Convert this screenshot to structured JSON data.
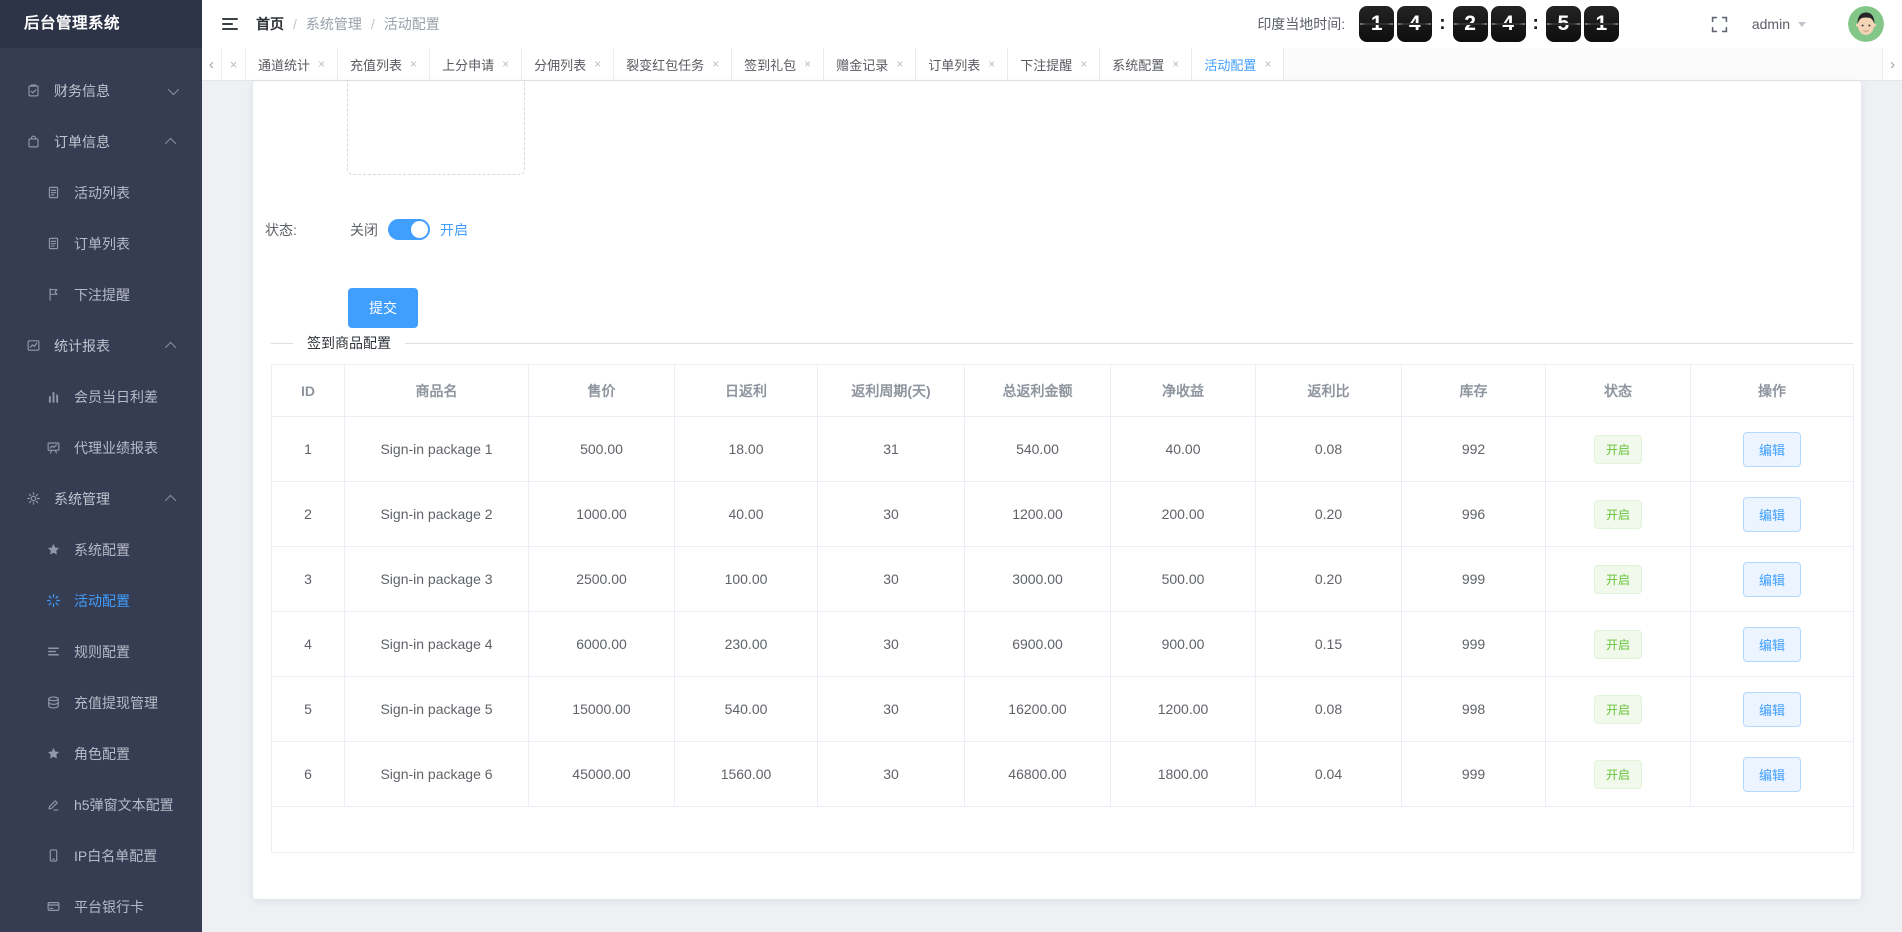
{
  "app": {
    "title": "后台管理系统"
  },
  "sidebar": {
    "items": [
      {
        "label": "财务信息",
        "icon": "clipboard-icon",
        "level": 1,
        "expanded": false
      },
      {
        "label": "订单信息",
        "icon": "bag-icon",
        "level": 1,
        "expanded": true
      },
      {
        "label": "活动列表",
        "icon": "doc-icon",
        "level": 2
      },
      {
        "label": "订单列表",
        "icon": "doc-icon",
        "level": 2
      },
      {
        "label": "下注提醒",
        "icon": "flag-icon",
        "level": 2
      },
      {
        "label": "统计报表",
        "icon": "chart-line-icon",
        "level": 1,
        "expanded": true
      },
      {
        "label": "会员当日利差",
        "icon": "bar-chart-icon",
        "level": 2
      },
      {
        "label": "代理业绩报表",
        "icon": "presentation-icon",
        "level": 2
      },
      {
        "label": "系统管理",
        "icon": "gear-icon",
        "level": 1,
        "expanded": true
      },
      {
        "label": "系统配置",
        "icon": "star-icon",
        "level": 2
      },
      {
        "label": "活动配置",
        "icon": "sparkle-icon",
        "level": 2,
        "active": true
      },
      {
        "label": "规则配置",
        "icon": "list-icon",
        "level": 2
      },
      {
        "label": "充值提现管理",
        "icon": "database-icon",
        "level": 2
      },
      {
        "label": "角色配置",
        "icon": "star-icon",
        "level": 2
      },
      {
        "label": "h5弹窗文本配置",
        "icon": "pencil-icon",
        "level": 2
      },
      {
        "label": "IP白名单配置",
        "icon": "mobile-icon",
        "level": 2
      },
      {
        "label": "平台银行卡",
        "icon": "card-icon",
        "level": 2
      }
    ]
  },
  "header": {
    "breadcrumb": [
      "首页",
      "系统管理",
      "活动配置"
    ],
    "separator": "/",
    "clock_label": "印度当地时间:",
    "clock_groups": [
      [
        "1",
        "4"
      ],
      [
        "2",
        "4"
      ],
      [
        "5",
        "1"
      ]
    ],
    "clock_colon": ":",
    "user": "admin"
  },
  "tabbar": {
    "prev_glyph": "‹",
    "close_glyph": "×",
    "next_glyph": "›",
    "tabs": [
      "通道统计",
      "充值列表",
      "上分申请",
      "分佣列表",
      "裂变红包任务",
      "签到礼包",
      "赠金记录",
      "订单列表",
      "下注提醒",
      "系统配置",
      "活动配置"
    ],
    "active_tab": "活动配置"
  },
  "form": {
    "status_label": "状态:",
    "off_label": "关闭",
    "on_label": "开启",
    "toggle_state": "on",
    "submit_label": "提交"
  },
  "section": {
    "title": "签到商品配置"
  },
  "table": {
    "headers": [
      "ID",
      "商品名",
      "售价",
      "日返利",
      "返利周期(天)",
      "总返利金额",
      "净收益",
      "返利比",
      "库存",
      "状态",
      "操作"
    ],
    "rows": [
      {
        "id": "1",
        "name": "Sign-in package 1",
        "price": "500.00",
        "daily_rebate": "18.00",
        "cycle": "31",
        "total_rebate": "540.00",
        "net_profit": "40.00",
        "ratio": "0.08",
        "stock": "992",
        "status": "开启",
        "action": "编辑"
      },
      {
        "id": "2",
        "name": "Sign-in package 2",
        "price": "1000.00",
        "daily_rebate": "40.00",
        "cycle": "30",
        "total_rebate": "1200.00",
        "net_profit": "200.00",
        "ratio": "0.20",
        "stock": "996",
        "status": "开启",
        "action": "编辑"
      },
      {
        "id": "3",
        "name": "Sign-in package 3",
        "price": "2500.00",
        "daily_rebate": "100.00",
        "cycle": "30",
        "total_rebate": "3000.00",
        "net_profit": "500.00",
        "ratio": "0.20",
        "stock": "999",
        "status": "开启",
        "action": "编辑"
      },
      {
        "id": "4",
        "name": "Sign-in package 4",
        "price": "6000.00",
        "daily_rebate": "230.00",
        "cycle": "30",
        "total_rebate": "6900.00",
        "net_profit": "900.00",
        "ratio": "0.15",
        "stock": "999",
        "status": "开启",
        "action": "编辑"
      },
      {
        "id": "5",
        "name": "Sign-in package 5",
        "price": "15000.00",
        "daily_rebate": "540.00",
        "cycle": "30",
        "total_rebate": "16200.00",
        "net_profit": "1200.00",
        "ratio": "0.08",
        "stock": "998",
        "status": "开启",
        "action": "编辑"
      },
      {
        "id": "6",
        "name": "Sign-in package 6",
        "price": "45000.00",
        "daily_rebate": "1560.00",
        "cycle": "30",
        "total_rebate": "46800.00",
        "net_profit": "1800.00",
        "ratio": "0.04",
        "stock": "999",
        "status": "开启",
        "action": "编辑"
      }
    ]
  },
  "colors": {
    "accent": "#409eff",
    "success": "#67c23a",
    "sidebar_bg": "#363c51",
    "content_bg": "#eef0f4",
    "clock_tile_bg": "#161616"
  }
}
